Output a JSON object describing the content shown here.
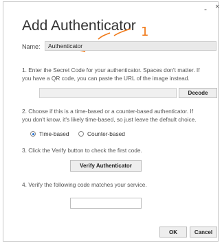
{
  "window": {
    "minimize_glyph": "-",
    "close_glyph": "×"
  },
  "dialog": {
    "title": "Add Authenticator",
    "name_label": "Name:",
    "name_value": "Authenticator",
    "annotation_number": "1",
    "step1_line1": "1. Enter the Secret Code for your authenticator. Spaces don't matter. If",
    "step1_line2": "you have a QR code, you can paste the URL of the image instead.",
    "decode_label": "Decode",
    "step2_line1": "2. Choose if this is a time-based or a counter-based authenticator. If",
    "step2_line2": "you don't know, it's likely time-based, so just leave the default choice.",
    "radio_time_label": "Time-based",
    "radio_counter_label": "Counter-based",
    "selected_type": "Time-based",
    "step3_text": "3. Click the Verify button to check the first code.",
    "verify_label": "Verify Authenticator",
    "step4_text": "4. Verify the following code matches your service.",
    "ok_label": "OK",
    "cancel_label": "Cancel"
  },
  "colors": {
    "annotation": "#f07a1a",
    "radio_selected": "#1f6fd6"
  }
}
